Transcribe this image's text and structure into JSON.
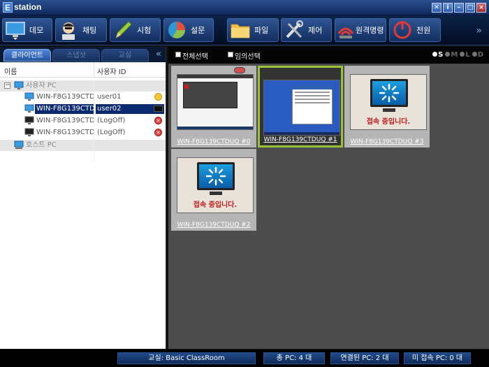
{
  "app": {
    "logo_letter": "E",
    "title": "station"
  },
  "window_buttons": [
    "tools-icon",
    "info-icon",
    "minimize-icon",
    "maximize-icon",
    "close-icon"
  ],
  "toolbar": {
    "demo": "데모",
    "chat": "채팅",
    "exam": "시험",
    "survey": "설문",
    "file": "파일",
    "control": "제어",
    "remote": "원격명령",
    "power": "전원",
    "more": "»"
  },
  "tabs": {
    "client": "클라이언트",
    "snapshot": "스냅샷",
    "classroom": "교실",
    "collapse": "«"
  },
  "columns": {
    "name": "이름",
    "user_id": "사용자 ID"
  },
  "tree": {
    "user_group": "사용자 PC",
    "host_group": "호스트 PC",
    "clients": [
      {
        "name": "WIN-F8G139CTDUQ",
        "user": "user01",
        "status": "yellow"
      },
      {
        "name": "WIN-F8G139CTDUQ",
        "user": "user02",
        "status": "monitor"
      },
      {
        "name": "WIN-F8G139CTDUQ",
        "user": "(LogOff)",
        "status": "red"
      },
      {
        "name": "WIN-F8G139CTDUQ",
        "user": "(LogOff)",
        "status": "red"
      }
    ]
  },
  "right_header": {
    "select_all": "전체선택",
    "random_select": "임의선택",
    "view_modes": [
      "S",
      "M",
      "L",
      "D"
    ],
    "active_view": "S"
  },
  "thumbnails": [
    {
      "caption": "WIN-F8G139CTDUQ #0",
      "state": "screen"
    },
    {
      "caption": "WIN-F8G139CTDUQ #1",
      "state": "screen-selected"
    },
    {
      "caption": "WIN-F8G139CTDUQ #3",
      "state": "connecting"
    },
    {
      "caption": "WIN-F8G139CTDUQ #2",
      "state": "connecting"
    }
  ],
  "connecting_text": "접속 중입니다.",
  "status": {
    "classroom": "교실: Basic ClassRoom",
    "total": "총 PC: 4 대",
    "connected": "연결된 PC: 2 대",
    "disconnected": "미 접속 PC: 0 대"
  },
  "colors": {
    "accent": "#2553a0",
    "selection": "#0b2a6e",
    "selected_border": "#9bc03a",
    "connecting_text": "#c21a1a"
  }
}
